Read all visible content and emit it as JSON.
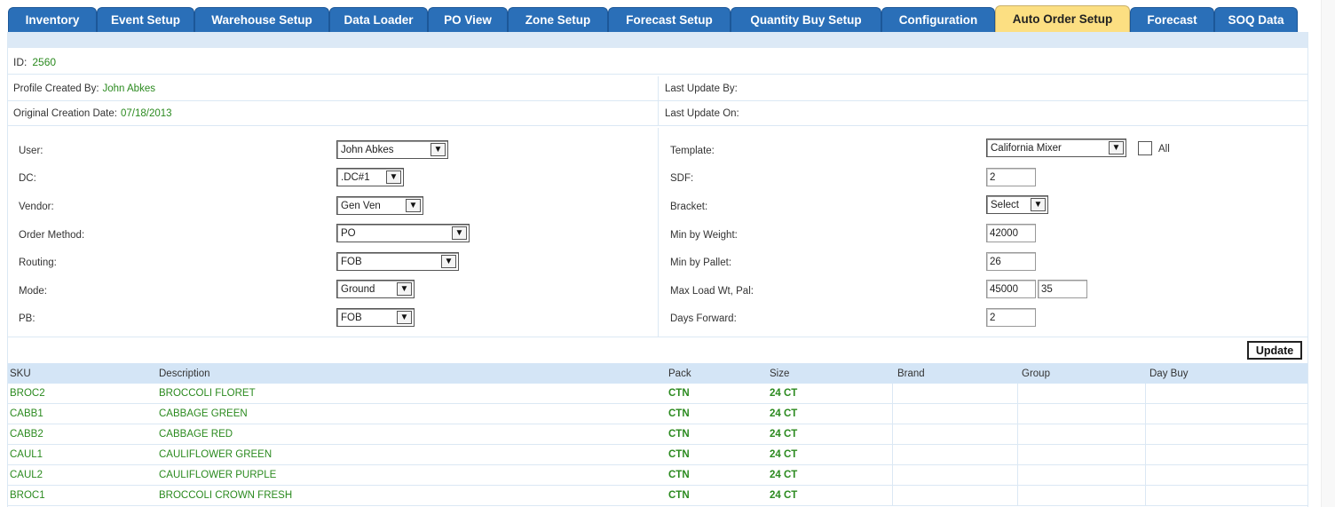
{
  "tabs": [
    {
      "label": "Inventory"
    },
    {
      "label": "Event Setup"
    },
    {
      "label": "Warehouse Setup"
    },
    {
      "label": "Data Loader"
    },
    {
      "label": "PO View"
    },
    {
      "label": "Zone Setup"
    },
    {
      "label": "Forecast Setup"
    },
    {
      "label": "Quantity Buy Setup"
    },
    {
      "label": "Configuration"
    },
    {
      "label": "Auto Order Setup",
      "active": true
    },
    {
      "label": "Forecast"
    },
    {
      "label": "SOQ Data"
    }
  ],
  "profile": {
    "id_label": "ID:",
    "id_value": "2560",
    "created_by_label": "Profile Created By:",
    "created_by_value": "John Abkes",
    "creation_date_label": "Original Creation Date:",
    "creation_date_value": "07/18/2013",
    "last_update_by_label": "Last Update By:",
    "last_update_on_label": "Last Update On:"
  },
  "form_left": {
    "user": {
      "label": "User:",
      "value": "John Abkes"
    },
    "dc": {
      "label": "DC:",
      "value": ".DC#1"
    },
    "vendor": {
      "label": "Vendor:",
      "value": "Gen Ven"
    },
    "order_method": {
      "label": "Order Method:",
      "value": "PO"
    },
    "routing": {
      "label": "Routing:",
      "value": "FOB"
    },
    "mode": {
      "label": "Mode:",
      "value": "Ground"
    },
    "pb": {
      "label": "PB:",
      "value": "FOB"
    }
  },
  "form_right": {
    "template": {
      "label": "Template:",
      "value": "California Mixer",
      "all_label": "All"
    },
    "sdf": {
      "label": "SDF:",
      "value": "2"
    },
    "bracket": {
      "label": "Bracket:",
      "value": "Select"
    },
    "min_weight": {
      "label": "Min by Weight:",
      "value": "42000"
    },
    "min_pallet": {
      "label": "Min by Pallet:",
      "value": "26"
    },
    "max_load": {
      "label": "Max Load Wt, Pal:",
      "weight": "45000",
      "pallet": "35"
    },
    "days_forward": {
      "label": "Days Forward:",
      "value": "2"
    }
  },
  "update_label": "Update",
  "grid": {
    "headers": {
      "sku": "SKU",
      "description": "Description",
      "pack": "Pack",
      "size": "Size",
      "brand": "Brand",
      "group": "Group",
      "day_buy": "Day Buy"
    },
    "rows": [
      {
        "sku": "BROC2",
        "description": "BROCCOLI FLORET",
        "pack": "CTN",
        "size": "24 CT"
      },
      {
        "sku": "CABB1",
        "description": "CABBAGE GREEN",
        "pack": "CTN",
        "size": "24 CT"
      },
      {
        "sku": "CABB2",
        "description": "CABBAGE RED",
        "pack": "CTN",
        "size": "24 CT"
      },
      {
        "sku": "CAUL1",
        "description": "CAULIFLOWER GREEN",
        "pack": "CTN",
        "size": "24 CT"
      },
      {
        "sku": "CAUL2",
        "description": "CAULIFLOWER PURPLE",
        "pack": "CTN",
        "size": "24 CT"
      },
      {
        "sku": "BROC1",
        "description": "BROCCOLI CROWN FRESH",
        "pack": "CTN",
        "size": "24 CT"
      }
    ]
  }
}
